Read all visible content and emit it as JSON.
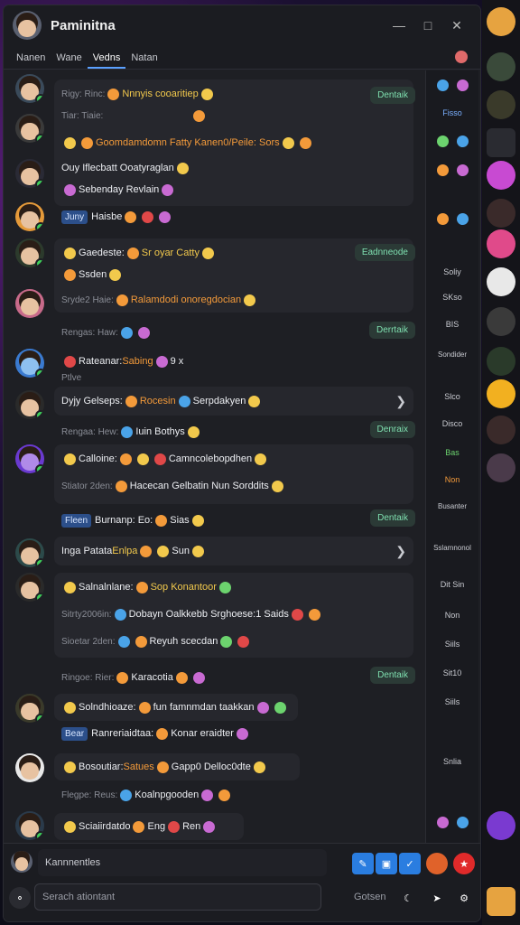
{
  "window": {
    "title": "Paminitna"
  },
  "tabs": [
    "Nanen",
    "Wane",
    "Vedns",
    "Natan"
  ],
  "messages": [
    {
      "lines": [
        "Rigy: Rinc:",
        "Nnnyis cooaritiep",
        "Tiar: Tiaie:",
        "Goomdamdomn Fatty Kanen0/Peile: Sors",
        "Ouy Iflecbatt Ooatyraglan",
        "Sebenday Revlain"
      ],
      "pill": "Dentaik"
    },
    {
      "lines": [
        "Juny",
        "Haisbe"
      ]
    },
    {
      "lines": [
        "Gaedeste:",
        "Sr oyar Catty",
        "Ssden",
        "Sryde2 Haie:",
        "Ralamdodi onoregdocian"
      ],
      "pill": "Eadnneode"
    },
    {
      "lines": [
        "Rengas: Haw:"
      ],
      "pill": "Derrtaik"
    },
    {
      "lines": [
        "Rateanar:",
        "Sabing",
        "9 x",
        "Ptlve"
      ]
    },
    {
      "lines": [
        "Dyjy Gelseps:",
        "Rocesin",
        "Serpdakyen"
      ]
    },
    {
      "lines": [
        "Rengaa: Hew:",
        "Iuin Bothys"
      ],
      "pill": "Denraix"
    },
    {
      "lines": [
        "Calloine:",
        "Camncolebopdhen",
        "Stiator 2den:",
        "Hacecan Gelbatin Nun Sorddits"
      ]
    },
    {
      "lines": [
        "Fleen",
        "Burnanp: Eo:",
        "Sias"
      ],
      "pill": "Dentaik"
    },
    {
      "lines": [
        "Inga Patata",
        "Enlpa",
        "Sun"
      ]
    },
    {
      "lines": [
        "Salnalnlane:",
        "Sop Konantoor",
        "Sitrty2006in:",
        "Dobayn Oalkkebb Srghoese:1 Saids",
        "Sioetar 2den:",
        "Reyuh scecdan"
      ]
    },
    {
      "lines": [
        "Ringoe: Rier:",
        "Karacotia"
      ],
      "pill": "Dentaik"
    },
    {
      "lines": [
        "Solndhioaze:",
        "fun famnmdan taakkan"
      ]
    },
    {
      "lines": [
        "Bear",
        "Ranreriaidtaa:",
        "Konar eraidter"
      ]
    },
    {
      "lines": [
        "Bosoutiar:",
        "Satues",
        "Gapp0 Delloc0dte"
      ]
    },
    {
      "lines": [
        "Flegpe: Reus:",
        "Koalnpgooden"
      ]
    },
    {
      "lines": [
        "Sciaiirdatdo",
        "Eng",
        "Ren"
      ]
    }
  ],
  "sidebar": [
    "Fisso",
    "Soliy",
    "SKso",
    "BIS",
    "Sondider",
    "Slco",
    "Disco",
    "Bas",
    "Non",
    "Busanter",
    "Sslamnonol",
    "Dit Sin",
    "Non",
    "Siils",
    "Sit10",
    "Siils",
    "Snlia"
  ],
  "composer": {
    "top_label": "Kannnentles",
    "placeholder": "Serach ationtant",
    "send_label": "Gotsen"
  },
  "colors": {
    "accent": "#5aa0ff",
    "online": "#3ecf5a",
    "pill": "#7fe0b0"
  }
}
